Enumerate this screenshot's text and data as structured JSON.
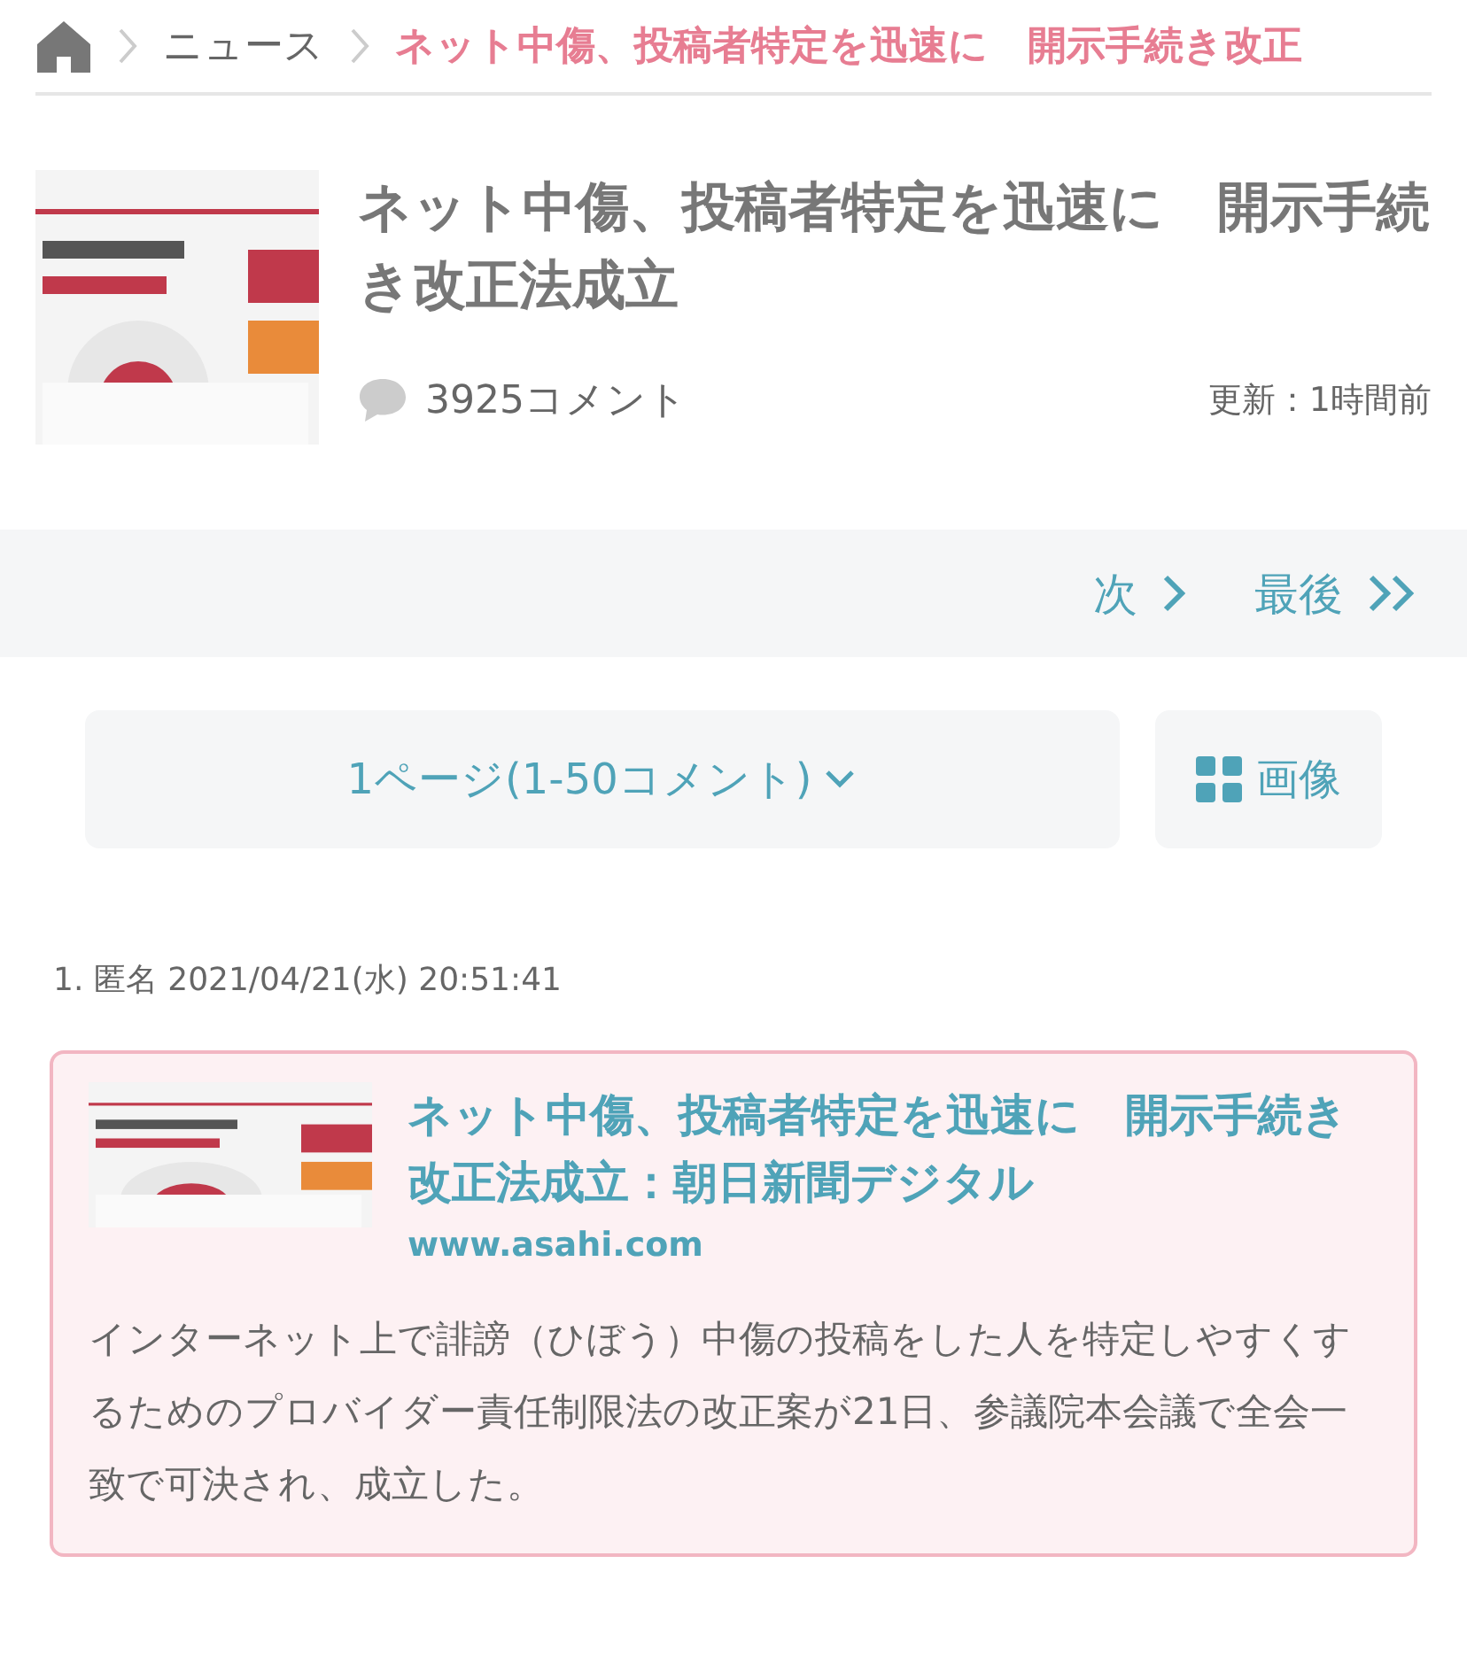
{
  "breadcrumb": [
    {
      "kind": "home"
    },
    {
      "kind": "link",
      "label": "ニュース"
    },
    {
      "kind": "current",
      "label": "ネット中傷、投稿者特定を迅速に　開示手続き改正"
    }
  ],
  "article": {
    "title": "ネット中傷、投稿者特定を迅速に　開示手続き改正法成立",
    "comments": "3925コメント",
    "updated": "更新：1時間前"
  },
  "pager": [
    {
      "label": "次",
      "kind": "single"
    },
    {
      "label": "最後",
      "kind": "double"
    }
  ],
  "page_select": "1ページ(1-50コメント)",
  "image_button": "画像",
  "comment": {
    "header": "1. 匿名 2021/04/21(水) 20:51:41",
    "link_card": {
      "title": "ネット中傷、投稿者特定を迅速に　開示手続き改正法成立：朝日新聞デジタル",
      "url": "www.asahi.com",
      "summary": "インターネット上で誹謗（ひぼう）中傷の投稿をした人を特定しやすくするためのプロバイダー責任制限法の改正案が21日、参議院本会議で全会一致で可決され、成立した。"
    }
  }
}
